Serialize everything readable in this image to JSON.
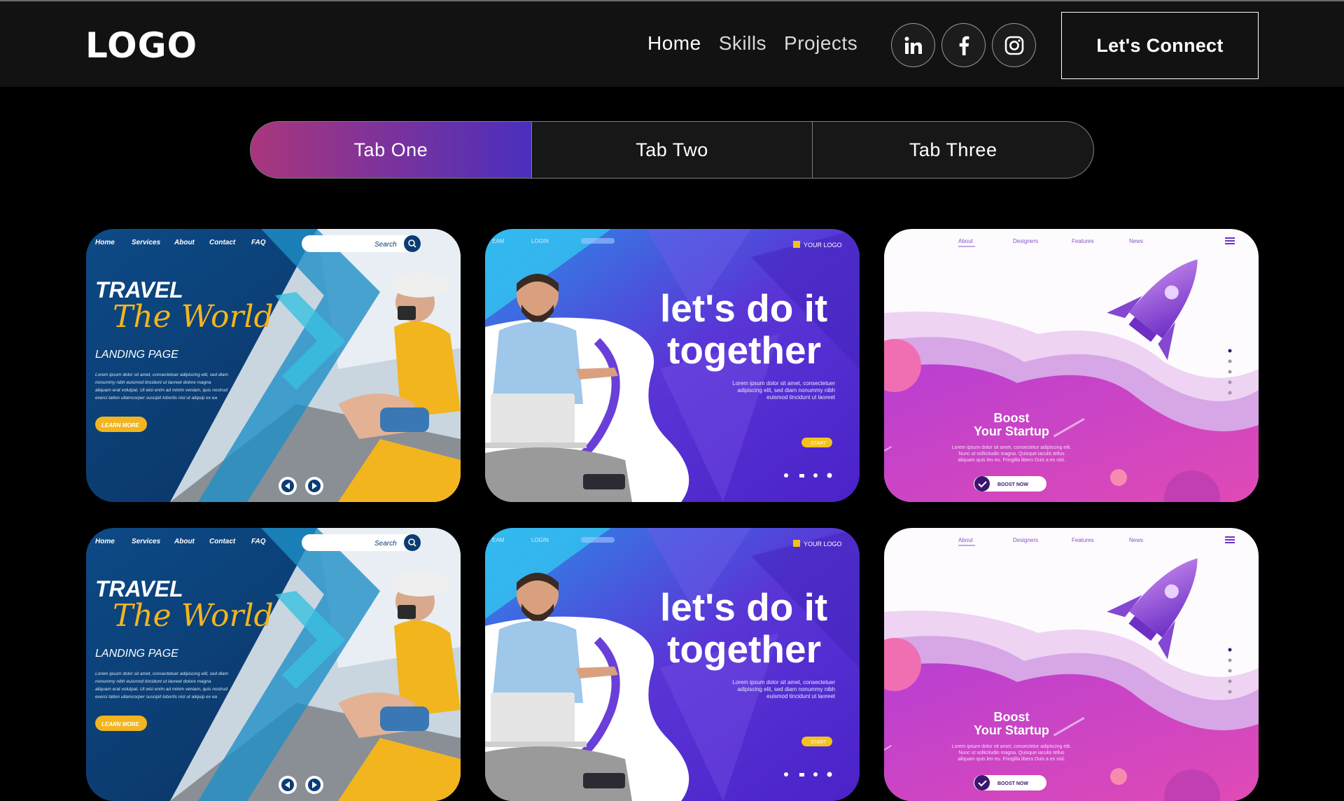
{
  "navbar": {
    "logo": "LOGO",
    "links": [
      {
        "label": "Home"
      },
      {
        "label": "Skills"
      },
      {
        "label": "Projects"
      }
    ],
    "social_icons": [
      "linkedin-icon",
      "facebook-icon",
      "instagram-icon"
    ],
    "connect_label": "Let's Connect"
  },
  "tabs": [
    {
      "label": "Tab One",
      "active": true
    },
    {
      "label": "Tab Two",
      "active": false
    },
    {
      "label": "Tab Three",
      "active": false
    }
  ],
  "colors": {
    "tab_gradient_start": "#aa367c",
    "tab_gradient_end": "#4a2fbd",
    "navbar_bg": "#121212",
    "page_bg": "#000000"
  },
  "travel": {
    "nav": [
      "Home",
      "Services",
      "About",
      "Contact",
      "FAQ"
    ],
    "search": "Search",
    "title": "TRAVEL",
    "script": "The World",
    "subtitle": "LANDING PAGE",
    "body": [
      "Lorem ipsum dolor sit amet, consectetuer adipiscing elit, sed diam",
      "nonummy nibh euismod tincidunt ut laoreet dolore magna",
      "aliquam erat volutpat. Ut wisi enim ad minim veniam, quis nostrud",
      "exerci tation ullamcorper suscipit lobortis nisl ut aliquip ex ea"
    ],
    "button": "LEARN MORE"
  },
  "together": {
    "nav": [
      "EAM",
      "LOGIN"
    ],
    "brand": "YOUR LOGO",
    "line1": "let's do it",
    "line2": "together",
    "body": [
      "Lorem ipsum dolor sit amet, consectetuer",
      "adipiscing elit, sed diam nonummy nibh",
      "euismod tincidunt ut laoreet"
    ],
    "button": "START"
  },
  "startup": {
    "nav": [
      "About",
      "Designers",
      "Features",
      "News"
    ],
    "title1": "Boost",
    "title2": "Your Startup",
    "body": [
      "Lorem ipsum dolor sit amet, consectetur adipiscing elit.",
      "Nunc ut sollicitudin magna. Quisque iaculis tellus",
      "aliquam quis leo eu. Fringilla libero Duis a ex nisl."
    ],
    "button": "BOOST NOW"
  }
}
